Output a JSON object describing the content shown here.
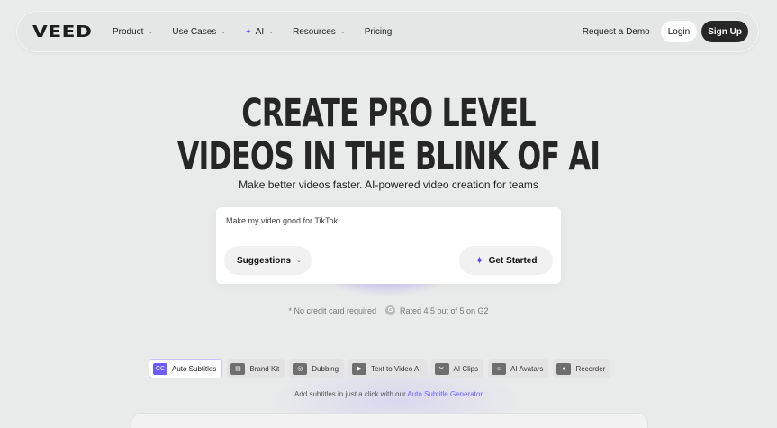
{
  "nav": {
    "logo": "VEED",
    "links": [
      {
        "label": "Product",
        "has_dropdown": true
      },
      {
        "label": "Use Cases",
        "has_dropdown": true
      },
      {
        "label": "AI",
        "has_dropdown": true,
        "icon": "sparkle-icon"
      },
      {
        "label": "Resources",
        "has_dropdown": true
      },
      {
        "label": "Pricing",
        "has_dropdown": false
      }
    ],
    "demo_label": "Request a Demo",
    "login_label": "Login",
    "signup_label": "Sign Up"
  },
  "hero": {
    "title_line1": "CREATE PRO LEVEL",
    "title_line2": "VIDEOS IN THE BLINK OF AI",
    "subtitle": "Make better videos faster. AI-powered video creation for teams"
  },
  "prompt": {
    "placeholder": "Make my video good for TikTok...",
    "value": "",
    "suggestions_label": "Suggestions",
    "start_label": "Get Started"
  },
  "trust": {
    "no_card": "* No credit card required",
    "rating": "Rated 4.5 out of 5 on G2"
  },
  "features": {
    "tabs": [
      {
        "label": "Auto Subtitles",
        "icon": "subtitles-icon",
        "glyph": "CC",
        "active": true
      },
      {
        "label": "Brand Kit",
        "icon": "brand-kit-icon",
        "glyph": "▤",
        "active": false
      },
      {
        "label": "Dubbing",
        "icon": "dubbing-icon",
        "glyph": "◎",
        "active": false
      },
      {
        "label": "Text to Video AI",
        "icon": "text-to-video-icon",
        "glyph": "▶",
        "active": false
      },
      {
        "label": "AI Clips",
        "icon": "clips-icon",
        "glyph": "✂",
        "active": false
      },
      {
        "label": "AI Avatars",
        "icon": "avatar-icon",
        "glyph": "☺",
        "active": false
      },
      {
        "label": "Recorder",
        "icon": "recorder-icon",
        "glyph": "●",
        "active": false
      }
    ],
    "caption_text": "Add subtitles in just a click with our ",
    "caption_link": "Auto Subtitle Generator"
  },
  "colors": {
    "background": "#e9eaea",
    "accent": "#6c5cff",
    "dark_button": "#272727"
  }
}
